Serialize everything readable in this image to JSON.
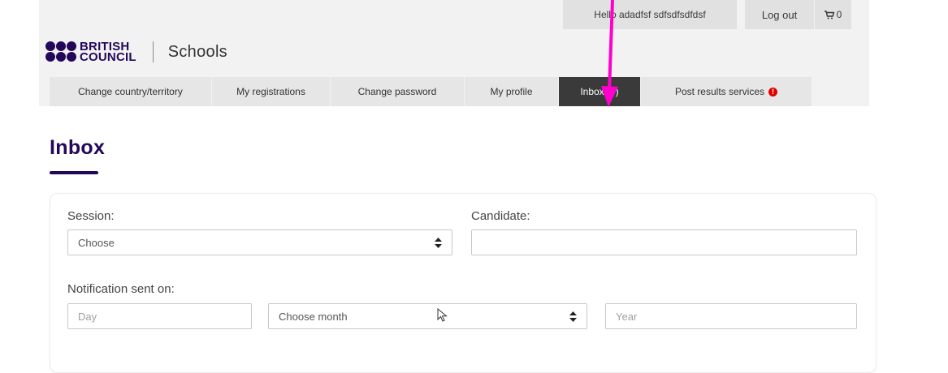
{
  "topbar": {
    "greeting": "Hello adadfsf sdfsdfsdfdsf",
    "logout_label": "Log out",
    "cart_count": "0",
    "cart_icon": "cart-icon"
  },
  "brand": {
    "logo_line1": "BRITISH",
    "logo_line2": "COUNCIL",
    "product": "Schools",
    "color": "#23085a"
  },
  "nav": {
    "items": [
      {
        "label": "Change country/territory"
      },
      {
        "label": "My registrations"
      },
      {
        "label": "Change password"
      },
      {
        "label": "My profile"
      },
      {
        "label": "Inbox (0)",
        "active": true
      },
      {
        "label": "Post results services",
        "badge": "!"
      }
    ]
  },
  "page": {
    "title": "Inbox"
  },
  "filters": {
    "session_label": "Session:",
    "session_value": "Choose",
    "candidate_label": "Candidate:",
    "candidate_value": "",
    "notification_label": "Notification sent on:",
    "day_placeholder": "Day",
    "month_value": "Choose month",
    "year_placeholder": "Year"
  },
  "annotation": {
    "arrow_color": "#ff00cc"
  }
}
